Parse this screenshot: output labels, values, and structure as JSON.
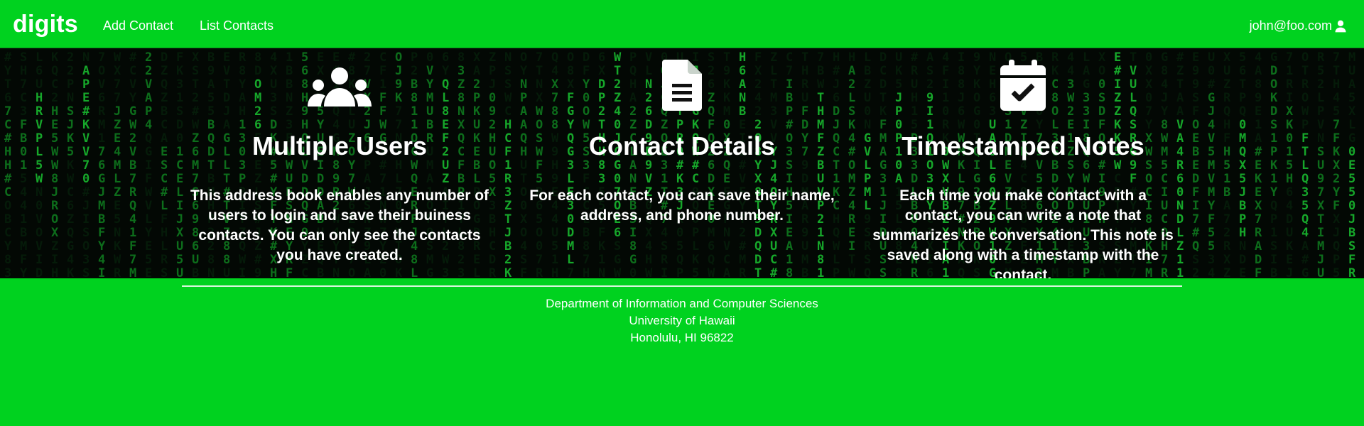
{
  "navbar": {
    "brand": "digits",
    "links": [
      "Add Contact",
      "List Contacts"
    ],
    "user_email": "john@foo.com"
  },
  "features": [
    {
      "icon": "users-icon",
      "title": "Multiple Users",
      "text": "This address book enables any number of users to login and save their buiness contacts. You can only see the contacts you have created."
    },
    {
      "icon": "document-icon",
      "title": "Contact Details",
      "text": "For each contact, you can save their name, address, and phone number."
    },
    {
      "icon": "calendar-check-icon",
      "title": "Timestamped Notes",
      "text": "Each time you make contact with a contact, you can write a note that summarizes the conversation. This note is saved along with a timestamp with the contact."
    }
  ],
  "footer": {
    "lines": [
      "Department of Information and Computer Sciences",
      "University of Hawaii",
      "Honolulu, HI 96822"
    ]
  },
  "colors": {
    "accent_green": "#00d21f",
    "hero_background": "#040a05",
    "matrix_green": "#1fe23a"
  }
}
